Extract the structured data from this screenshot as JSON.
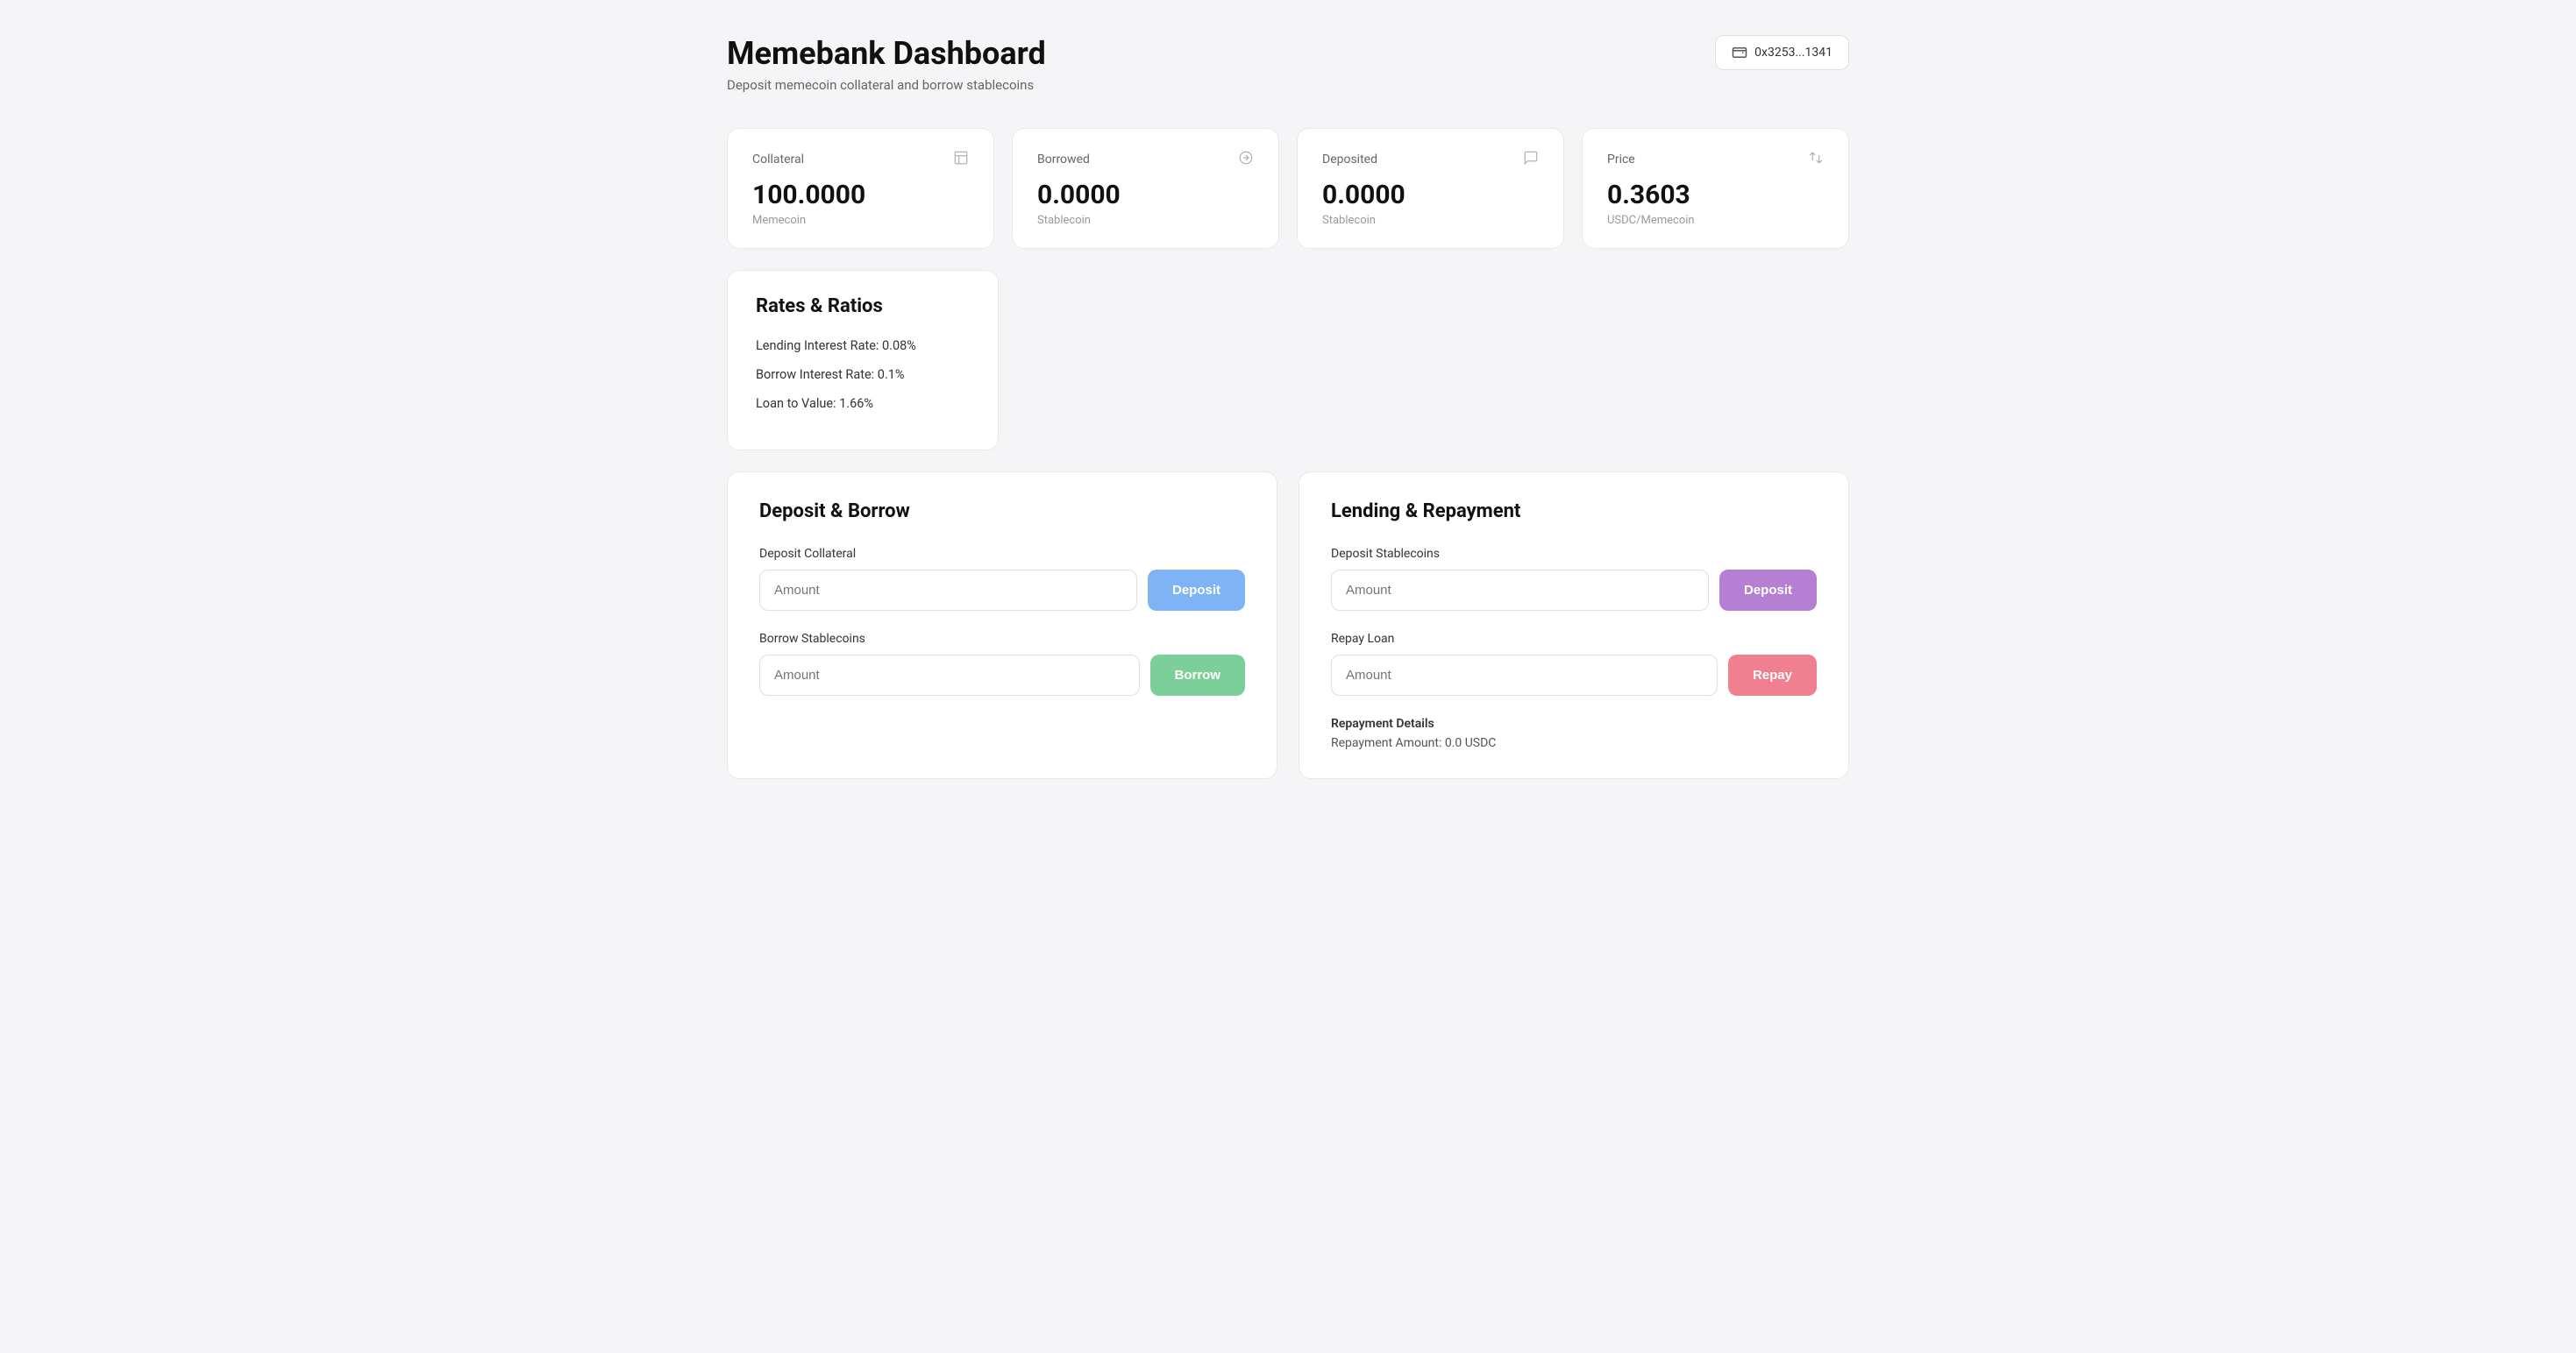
{
  "header": {
    "title": "Memebank Dashboard",
    "subtitle": "Deposit memecoin collateral and borrow stablecoins",
    "wallet": {
      "address": "0x3253...1341",
      "icon": "wallet-icon"
    }
  },
  "stats": [
    {
      "label": "Collateral",
      "value": "100.0000",
      "unit": "Memecoin",
      "icon": "📋"
    },
    {
      "label": "Borrowed",
      "value": "0.0000",
      "unit": "Stablecoin",
      "icon": "🔗"
    },
    {
      "label": "Deposited",
      "value": "0.0000",
      "unit": "Stablecoin",
      "icon": "💬"
    },
    {
      "label": "Price",
      "value": "0.3603",
      "unit": "USDC/Memecoin",
      "icon": "↕"
    }
  ],
  "rates": {
    "title": "Rates & Ratios",
    "items": [
      "Lending Interest Rate: 0.08%",
      "Borrow Interest Rate: 0.1%",
      "Loan to Value: 1.66%"
    ]
  },
  "deposit_borrow": {
    "title": "Deposit & Borrow",
    "deposit_collateral": {
      "label": "Deposit Collateral",
      "placeholder": "Amount",
      "button": "Deposit"
    },
    "borrow_stablecoins": {
      "label": "Borrow Stablecoins",
      "placeholder": "Amount",
      "button": "Borrow"
    }
  },
  "lending_repayment": {
    "title": "Lending & Repayment",
    "deposit_stablecoins": {
      "label": "Deposit Stablecoins",
      "placeholder": "Amount",
      "button": "Deposit"
    },
    "repay_loan": {
      "label": "Repay Loan",
      "placeholder": "Amount",
      "button": "Repay"
    },
    "repayment_details": {
      "title": "Repayment Details",
      "amount_label": "Repayment Amount: 0.0 USDC"
    }
  }
}
